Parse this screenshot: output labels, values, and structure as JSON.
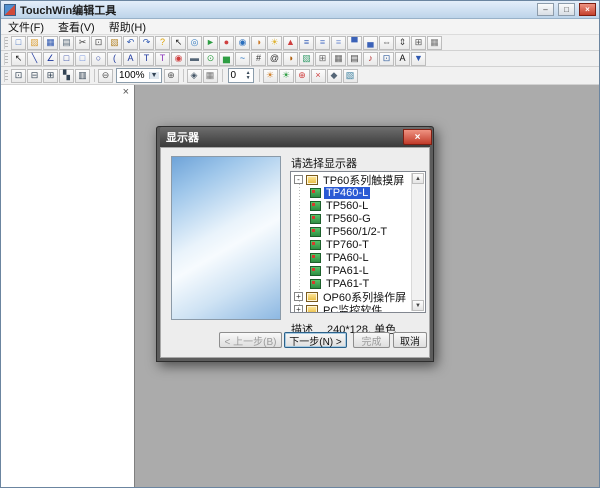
{
  "colors": {
    "selection": "#2a5ad4",
    "dialog_close": "#c13b2a",
    "titlebar": "#bdd4ea"
  },
  "window": {
    "title": "TouchWin编辑工具",
    "controls": {
      "minimize": "–",
      "maximize": "□",
      "close": "×"
    }
  },
  "menubar": {
    "items": [
      {
        "name": "menu-file",
        "label": "文件(F)"
      },
      {
        "name": "menu-view",
        "label": "查看(V)"
      },
      {
        "name": "menu-help",
        "label": "帮助(H)"
      }
    ]
  },
  "toolbars": {
    "row1": [
      {
        "name": "new-icon",
        "glyph": "□",
        "color": "#3c6cc0"
      },
      {
        "name": "open-icon",
        "glyph": "▨",
        "color": "#dca23e"
      },
      {
        "name": "save-icon",
        "glyph": "▦",
        "color": "#2f58b0"
      },
      {
        "name": "print-icon",
        "glyph": "▤",
        "color": "#5a6b7a"
      },
      {
        "name": "cut-icon",
        "glyph": "✂",
        "color": "#3a3a3a"
      },
      {
        "name": "copy-icon",
        "glyph": "⊡",
        "color": "#4a4a4a"
      },
      {
        "name": "paste-icon",
        "glyph": "▧",
        "color": "#b5862e"
      },
      {
        "name": "undo-icon",
        "glyph": "↶",
        "color": "#2f58b0"
      },
      {
        "name": "redo-icon",
        "glyph": "↷",
        "color": "#2f58b0"
      },
      {
        "name": "help-icon",
        "glyph": "?",
        "color": "#dca000"
      },
      {
        "name": "pointer-icon",
        "glyph": "↖",
        "color": "#222222"
      },
      {
        "name": "zoom-tool-icon",
        "glyph": "◎",
        "color": "#2f79bf"
      },
      {
        "name": "simulate-icon",
        "glyph": "►",
        "color": "#2f9e44"
      },
      {
        "name": "stop-icon",
        "glyph": "●",
        "color": "#cf3f3f"
      },
      {
        "name": "eye-icon",
        "glyph": "◉",
        "color": "#2a6fbd"
      },
      {
        "name": "clock-icon",
        "glyph": "◑",
        "color": "#cc7a29"
      },
      {
        "name": "lamp-icon",
        "glyph": "☀",
        "color": "#dfb32f"
      },
      {
        "name": "flag-icon",
        "glyph": "▲",
        "color": "#cf3f3f"
      },
      {
        "name": "align-left-icon",
        "glyph": "≡",
        "color": "#3b62b8"
      },
      {
        "name": "align-center-icon",
        "glyph": "≡",
        "color": "#5b7cc8"
      },
      {
        "name": "align-right-icon",
        "glyph": "≡",
        "color": "#7d97d4"
      },
      {
        "name": "align-top-icon",
        "glyph": "▀",
        "color": "#3b62b8"
      },
      {
        "name": "align-bottom-icon",
        "glyph": "▄",
        "color": "#3b62b8"
      },
      {
        "name": "same-width-icon",
        "glyph": "⇔",
        "color": "#444444"
      },
      {
        "name": "same-height-icon",
        "glyph": "⇕",
        "color": "#444444"
      },
      {
        "name": "group-icon",
        "glyph": "⊞",
        "color": "#555555"
      },
      {
        "name": "grid-icon",
        "glyph": "▦",
        "color": "#777777"
      }
    ],
    "row2": [
      {
        "name": "select-icon",
        "glyph": "↖",
        "color": "#222222"
      },
      {
        "name": "line-icon",
        "glyph": "╲",
        "color": "#203a9e"
      },
      {
        "name": "polyline-icon",
        "glyph": "∠",
        "color": "#203a9e"
      },
      {
        "name": "rect-icon",
        "glyph": "□",
        "color": "#203a9e"
      },
      {
        "name": "round-rect-icon",
        "glyph": "□",
        "color": "#5a7fd8"
      },
      {
        "name": "ellipse-icon",
        "glyph": "○",
        "color": "#203a9e"
      },
      {
        "name": "arc-icon",
        "glyph": "(",
        "color": "#203a9e"
      },
      {
        "name": "text-icon",
        "glyph": "A",
        "color": "#203a9e"
      },
      {
        "name": "static-text-icon",
        "glyph": "T",
        "color": "#203a9e"
      },
      {
        "name": "dynamic-text-icon",
        "glyph": "T",
        "color": "#8a35b8"
      },
      {
        "name": "indicator-lamp-icon",
        "glyph": "◉",
        "color": "#cf3f3f"
      },
      {
        "name": "button-icon",
        "glyph": "▬",
        "color": "#556677"
      },
      {
        "name": "switch-icon",
        "glyph": "⊙",
        "color": "#2f9e44"
      },
      {
        "name": "bargraph-icon",
        "glyph": "▅",
        "color": "#2f9e44"
      },
      {
        "name": "trend-icon",
        "glyph": "~",
        "color": "#1f6fbf"
      },
      {
        "name": "number-display-icon",
        "glyph": "#",
        "color": "#333333"
      },
      {
        "name": "text-input-icon",
        "glyph": "@",
        "color": "#333333"
      },
      {
        "name": "time-display-icon",
        "glyph": "◑",
        "color": "#b06010"
      },
      {
        "name": "image-icon",
        "glyph": "▧",
        "color": "#3a9e6e"
      },
      {
        "name": "scale-icon",
        "glyph": "⊞",
        "color": "#666666"
      },
      {
        "name": "table-icon",
        "glyph": "▦",
        "color": "#666666"
      },
      {
        "name": "keyboard-icon",
        "glyph": "▤",
        "color": "#444444"
      },
      {
        "name": "alarm-icon",
        "glyph": "♪",
        "color": "#b22222"
      },
      {
        "name": "window-icon",
        "glyph": "⊡",
        "color": "#335f9e"
      },
      {
        "name": "font-icon",
        "glyph": "A",
        "color": "#111111"
      },
      {
        "name": "download-icon",
        "glyph": "▼",
        "color": "#2f58b0"
      }
    ],
    "row3_group1": [
      {
        "name": "cascade-windows-icon",
        "glyph": "⊡",
        "color": "#334455"
      },
      {
        "name": "tile-horizontal-icon",
        "glyph": "⊟",
        "color": "#334455"
      },
      {
        "name": "tile-vertical-icon",
        "glyph": "⊞",
        "color": "#334455"
      },
      {
        "name": "arrange-icons-icon",
        "glyph": "▚",
        "color": "#334455"
      },
      {
        "name": "toolbox-icon",
        "glyph": "▥",
        "color": "#334455"
      }
    ],
    "zoom": {
      "out_glyph": "⊖",
      "in_glyph": "⊕",
      "value": "100%",
      "arrow": "▼"
    },
    "row3_group2": [
      {
        "name": "pan-icon",
        "glyph": "◈",
        "color": "#445566"
      },
      {
        "name": "grid-toggle-icon",
        "glyph": "▦",
        "color": "#777777"
      }
    ],
    "spinner": {
      "value": "0",
      "up_glyph": "▲",
      "down_glyph": "▼"
    },
    "row3_group3": [
      {
        "name": "offline-simulate-icon",
        "glyph": "☀",
        "color": "#d0822f"
      },
      {
        "name": "online-simulate-icon",
        "glyph": "☀",
        "color": "#2f9e44"
      },
      {
        "name": "download-app-icon",
        "glyph": "⊕",
        "color": "#cf3f3f"
      },
      {
        "name": "clear-icon",
        "glyph": "×",
        "color": "#cf3f3f"
      },
      {
        "name": "system-settings-icon",
        "glyph": "◆",
        "color": "#556677"
      },
      {
        "name": "image-library-icon",
        "glyph": "▧",
        "color": "#3a7f9e"
      }
    ]
  },
  "left_panel": {
    "close_label": "×"
  },
  "dialog": {
    "title": "显示器",
    "close_label": "×",
    "prompt": "请选择显示器",
    "tree": {
      "root": {
        "label": "TP60系列触摸屏",
        "state": "expanded",
        "expander": "-"
      },
      "children": [
        {
          "label": "TP460-L",
          "selected": true
        },
        {
          "label": "TP560-L"
        },
        {
          "label": "TP560-G"
        },
        {
          "label": "TP560/1/2-T"
        },
        {
          "label": "TP760-T"
        },
        {
          "label": "TPA60-L"
        },
        {
          "label": "TPA61-L"
        },
        {
          "label": "TPA61-T"
        }
      ],
      "collapsed_nodes": [
        {
          "label": "OP60系列操作屏",
          "expander": "+"
        },
        {
          "label": "PC监控软件",
          "expander": "+"
        }
      ],
      "scroll": {
        "up_glyph": "▲",
        "down_glyph": "▼"
      }
    },
    "description_label": "描述",
    "description_value": "240*128, 单色",
    "buttons": [
      {
        "name": "back-button",
        "label": "< 上一步(B)",
        "enabled": false,
        "focused": false
      },
      {
        "name": "next-button",
        "label": "下一步(N) >",
        "enabled": true,
        "focused": true
      },
      {
        "name": "finish-button",
        "label": "完成",
        "enabled": false,
        "focused": false
      },
      {
        "name": "cancel-button",
        "label": "取消",
        "enabled": true,
        "focused": false
      }
    ]
  }
}
